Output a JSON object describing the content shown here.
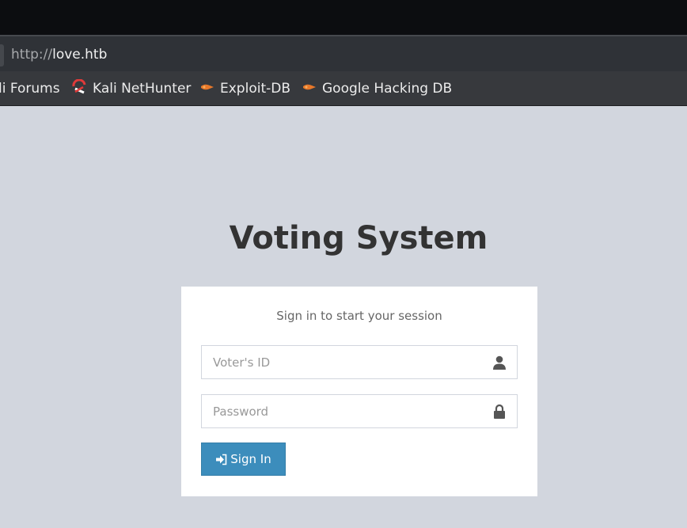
{
  "browser": {
    "url_scheme": "http://",
    "url_host": "love.htb",
    "bookmarks": [
      {
        "label": "li Forums",
        "icon": "none"
      },
      {
        "label": "Kali NetHunter",
        "icon": "nethunter-icon"
      },
      {
        "label": "Exploit-DB",
        "icon": "exploit-db-icon"
      },
      {
        "label": "Google Hacking DB",
        "icon": "exploit-db-icon"
      }
    ]
  },
  "page": {
    "title": "Voting System",
    "login_message": "Sign in to start your session",
    "voter_id_placeholder": "Voter's ID",
    "password_placeholder": "Password",
    "sign_in_label": "Sign In",
    "user_icon": "user-icon",
    "lock_icon": "lock-icon",
    "sign_in_icon": "sign-in-icon"
  },
  "colors": {
    "background": "#d2d6de",
    "button": "#3c8dbc",
    "title": "#333333"
  }
}
